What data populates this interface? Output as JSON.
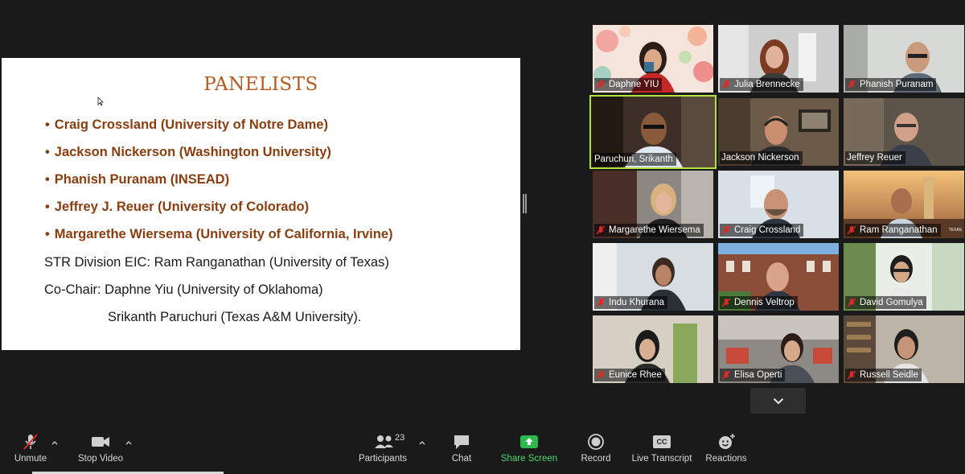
{
  "slide": {
    "title": "PANELISTS",
    "panelists": [
      "Craig Crossland (University of Notre Dame)",
      "Jackson Nickerson (Washington University)",
      "Phanish Puranam (INSEAD)",
      "Jeffrey J. Reuer (University of Colorado)",
      "Margarethe Wiersema (University of California, Irvine)"
    ],
    "bullet": "•",
    "eic_line": "STR Division EIC: Ram Ranganathan (University of Texas)",
    "cochair_line": "Co-Chair: Daphne Yiu (University of Oklahoma)",
    "cochair_line2": "Srikanth Paruchuri (Texas A&M University)."
  },
  "participants_grid": [
    {
      "name": "Daphne YIU",
      "muted": true
    },
    {
      "name": "Julia Brennecke",
      "muted": true
    },
    {
      "name": "Phanish Puranam",
      "muted": true
    },
    {
      "name": "Paruchuri, Srikanth",
      "muted": false,
      "active_speaker": true
    },
    {
      "name": "Jackson Nickerson",
      "muted": false
    },
    {
      "name": "Jeffrey Reuer",
      "muted": false
    },
    {
      "name": "Margarethe Wiersema",
      "muted": true
    },
    {
      "name": "Craig Crossland",
      "muted": true
    },
    {
      "name": "Ram Ranganathan",
      "muted": true,
      "overlay_text": "TEXAS"
    },
    {
      "name": "Indu Khurana",
      "muted": true
    },
    {
      "name": "Dennis Veltrop",
      "muted": true
    },
    {
      "name": "David Gomulya",
      "muted": true
    },
    {
      "name": "Eunice Rhee",
      "muted": true
    },
    {
      "name": "Elisa Operti",
      "muted": true
    },
    {
      "name": "Russell Seidle",
      "muted": true
    }
  ],
  "toolbar": {
    "unmute": "Unmute",
    "stop_video": "Stop Video",
    "participants": "Participants",
    "participants_count": "23",
    "chat": "Chat",
    "share_screen": "Share Screen",
    "record": "Record",
    "live_transcript": "Live Transcript",
    "cc_badge": "CC",
    "reactions": "Reactions"
  },
  "colors": {
    "background": "#1a1a1a",
    "slide_title": "#b35a1f",
    "panelist_text": "#8a3e10",
    "active_speaker_border": "#b5e33d",
    "share_green": "#4ad66d",
    "muted_red": "#e02828"
  },
  "icons": {
    "unmute": "muted-mic-icon",
    "stop_video": "video-camera-icon",
    "participants": "participants-icon",
    "chat": "chat-bubble-icon",
    "share_screen": "share-screen-icon",
    "record": "record-icon",
    "live_transcript": "cc-icon",
    "reactions": "emoji-add-icon",
    "expand": "chevron-down-icon"
  }
}
